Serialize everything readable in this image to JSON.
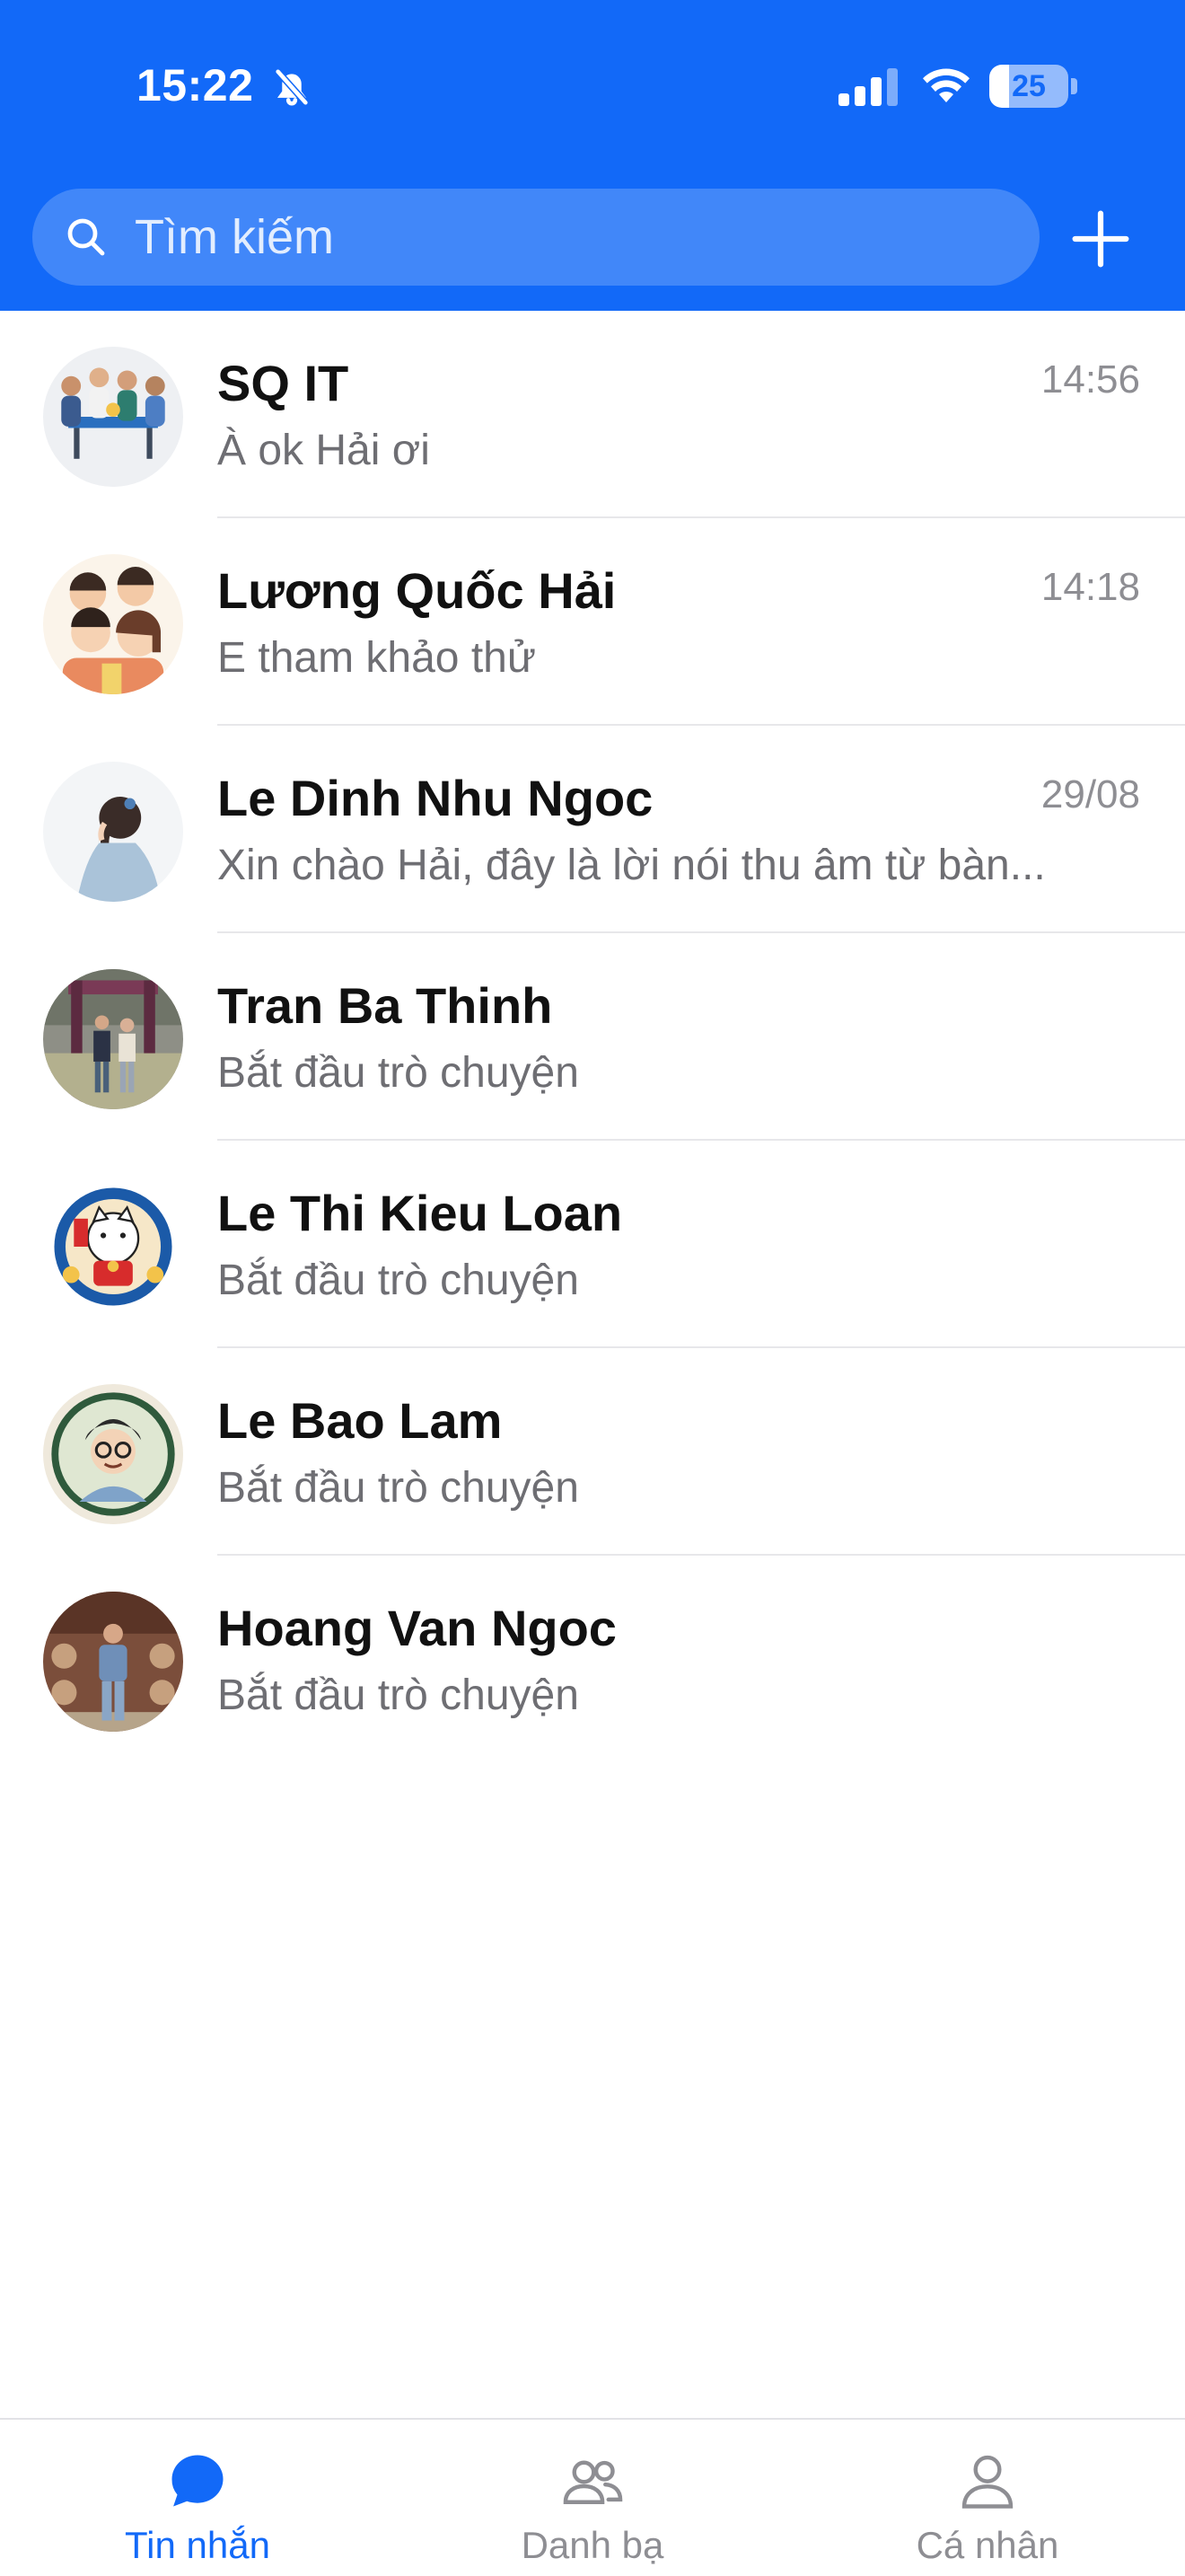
{
  "status_bar": {
    "time": "15:22",
    "battery": "25",
    "battery_level": 0.25
  },
  "header": {
    "search": {
      "placeholder": "Tìm kiếm",
      "value": ""
    },
    "add_icon": "plus-icon"
  },
  "conversations": [
    {
      "name": "SQ IT",
      "message": "À ok Hải ơi",
      "time": "14:56",
      "avatar": "group-avatar"
    },
    {
      "name": "Lương Quốc Hải",
      "message": "E tham khảo thử",
      "time": "14:18",
      "avatar": "family-illustration-avatar"
    },
    {
      "name": "Le Dinh Nhu Ngoc",
      "message": "Xin chào Hải, đây là lời nói thu âm từ bàn...",
      "time": "29/08",
      "avatar": "braid-girl-avatar"
    },
    {
      "name": "Tran Ba Thinh",
      "message": "Bắt đầu trò chuyện",
      "time": "",
      "avatar": "couple-photo-avatar"
    },
    {
      "name": "Le Thi Kieu Loan",
      "message": "Bắt đầu trò chuyện",
      "time": "",
      "avatar": "lucky-cat-avatar"
    },
    {
      "name": "Le Bao Lam",
      "message": "Bắt đầu trò chuyện",
      "time": "",
      "avatar": "cartoon-man-glasses-avatar"
    },
    {
      "name": "Hoang Van Ngoc",
      "message": "Bắt đầu trò chuyện",
      "time": "",
      "avatar": "man-photo-avatar"
    }
  ],
  "tabbar": {
    "tabs": [
      {
        "label": "Tin nhắn",
        "icon": "chat-bubble-icon",
        "active": true
      },
      {
        "label": "Danh bạ",
        "icon": "contacts-icon",
        "active": false
      },
      {
        "label": "Cá nhân",
        "icon": "person-icon",
        "active": false
      }
    ]
  },
  "colors": {
    "brand": "#1269f8",
    "text": "#111111",
    "secondary": "#6e6e73"
  }
}
